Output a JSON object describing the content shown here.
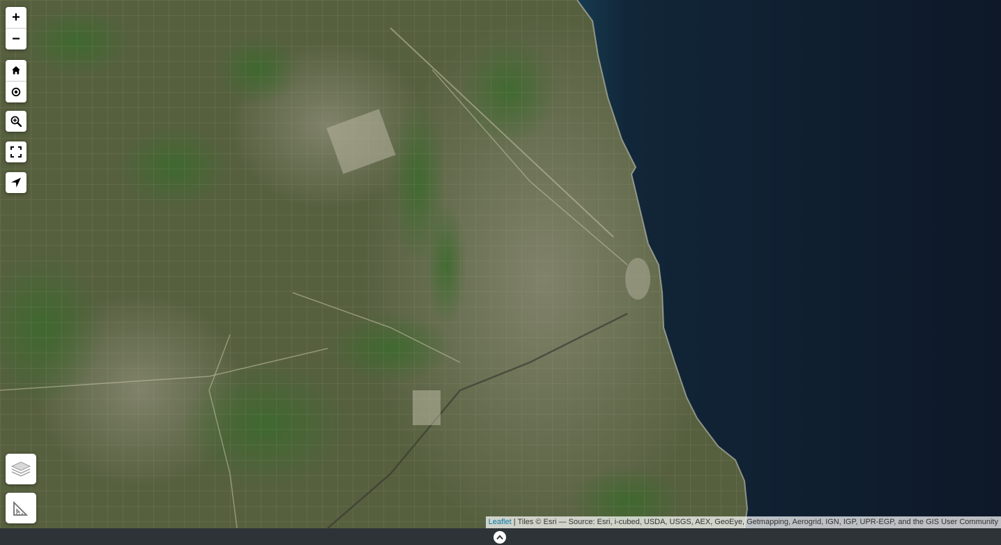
{
  "map": {
    "type": "satellite-imagery",
    "lake_color": "#0f1a2a",
    "land_color": "#4d5a3a"
  },
  "controls": {
    "zoom_in_label": "+",
    "zoom_out_label": "−",
    "icons": [
      "home-icon",
      "locate-target-icon",
      "zoom-box-icon",
      "fullscreen-icon",
      "navigate-arrow-icon",
      "layers-icon",
      "measure-icon"
    ]
  },
  "attribution": {
    "link_text": "Leaflet",
    "text": " | Tiles © Esri — Source: Esri, i-cubed, USDA, USGS, AEX, GeoEye, Getmapping, Aerogrid, IGN, IGP, UPR-EGP, and the GIS User Community"
  },
  "footer": {
    "icon": "chevron-up-icon"
  }
}
